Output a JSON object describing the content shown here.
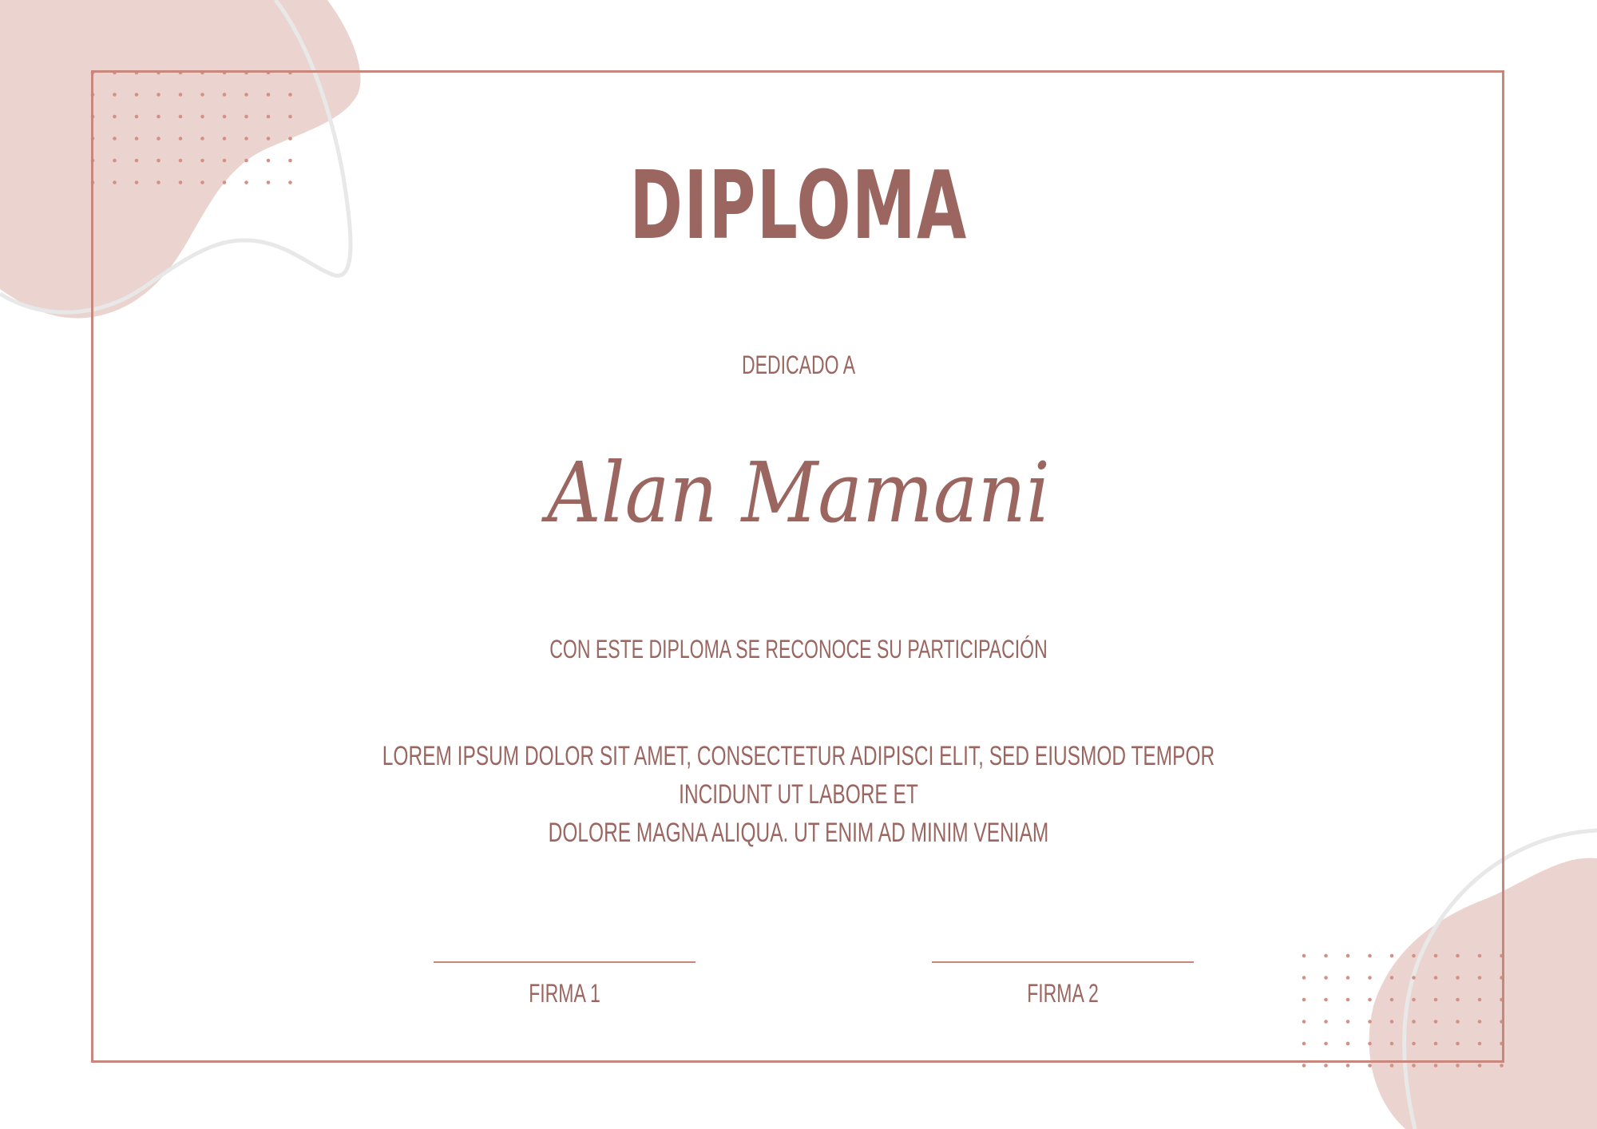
{
  "certificate": {
    "title": "DIPLOMA",
    "dedication": "DEDICADO A",
    "recipient": "Alan Mamani",
    "recognition": "CON ESTE DIPLOMA SE RECONOCE SU PARTICIPACIÓN",
    "body_line_1": "LOREM IPSUM DOLOR SIT AMET, CONSECTETUR ADIPISCI ELIT, SED EIUSMOD TEMPOR INCIDUNT UT LABORE ET",
    "body_line_2": "DOLORE MAGNA ALIQUA. UT ENIM AD MINIM VENIAM",
    "signature_1": "FIRMA 1",
    "signature_2": "FIRMA 2"
  },
  "colors": {
    "text": "#9b6660",
    "frame": "#c7877d",
    "blob": "#ebd4cf",
    "dots": "#d39084",
    "swirl": "#e8e8e8",
    "background": "#ffffff"
  }
}
